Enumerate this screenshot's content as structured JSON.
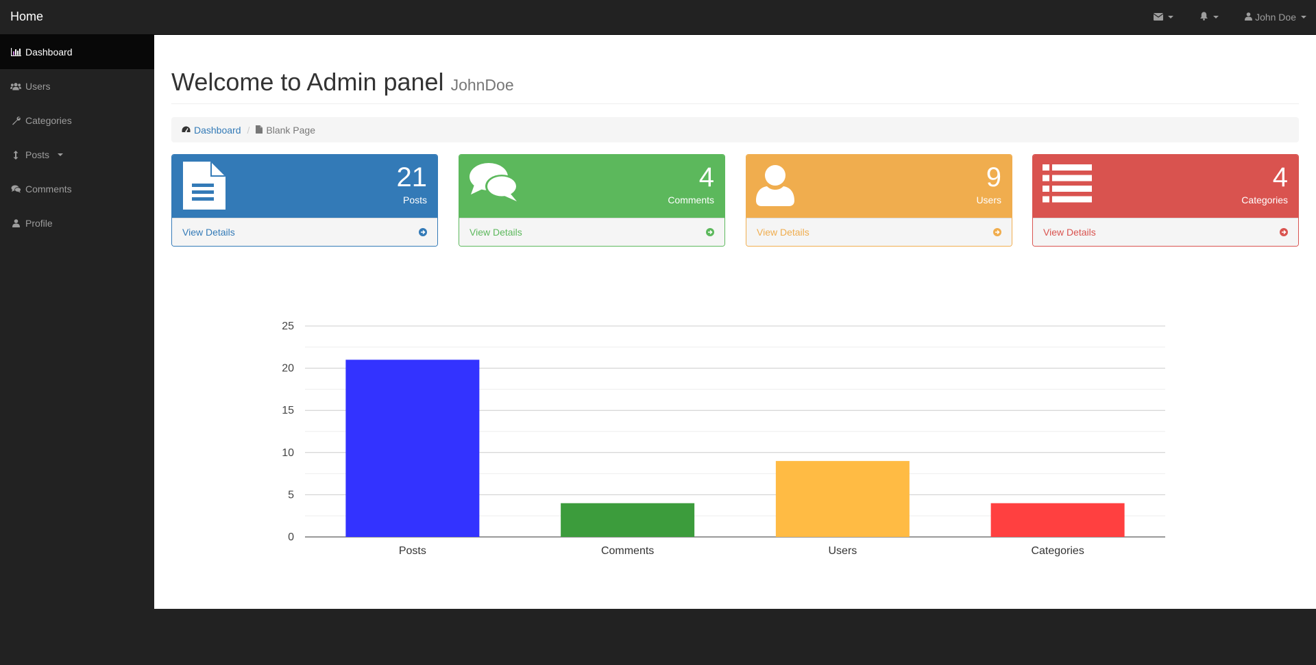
{
  "navbar": {
    "brand": "Home",
    "user_label": "John Doe",
    "icons": [
      "envelope-icon",
      "bell-icon",
      "user-icon"
    ]
  },
  "sidebar": {
    "items": [
      {
        "label": "Dashboard",
        "icon": "bar-chart-icon",
        "active": true
      },
      {
        "label": "Users",
        "icon": "users-icon",
        "active": false
      },
      {
        "label": "Categories",
        "icon": "wrench-icon",
        "active": false
      },
      {
        "label": "Posts",
        "icon": "arrows-v-icon",
        "active": false,
        "has_caret": true
      },
      {
        "label": "Comments",
        "icon": "comments-icon",
        "active": false
      },
      {
        "label": "Profile",
        "icon": "user-icon",
        "active": false
      }
    ]
  },
  "header": {
    "title": "Welcome to Admin panel",
    "subtitle": "JohnDoe"
  },
  "breadcrumb": {
    "link": "Dashboard",
    "current": "Blank Page"
  },
  "panels": [
    {
      "count": "21",
      "label": "Posts",
      "details": "View Details",
      "color": "#337ab7",
      "icon": "file-text-icon"
    },
    {
      "count": "4",
      "label": "Comments",
      "details": "View Details",
      "color": "#5cb85c",
      "icon": "comments-icon"
    },
    {
      "count": "9",
      "label": "Users",
      "details": "View Details",
      "color": "#f0ad4e",
      "icon": "user-icon"
    },
    {
      "count": "4",
      "label": "Categories",
      "details": "View Details",
      "color": "#d9534f",
      "icon": "list-icon"
    }
  ],
  "chart_data": {
    "type": "bar",
    "categories": [
      "Posts",
      "Comments",
      "Users",
      "Categories"
    ],
    "values": [
      21,
      4,
      9,
      4
    ],
    "colors": [
      "#3333ff",
      "#3c9c3c",
      "#ffbb44",
      "#ff4040"
    ],
    "ylim": [
      0,
      25
    ],
    "yticks": [
      0,
      5,
      10,
      15,
      20,
      25
    ],
    "grid": true,
    "legend": "none"
  }
}
